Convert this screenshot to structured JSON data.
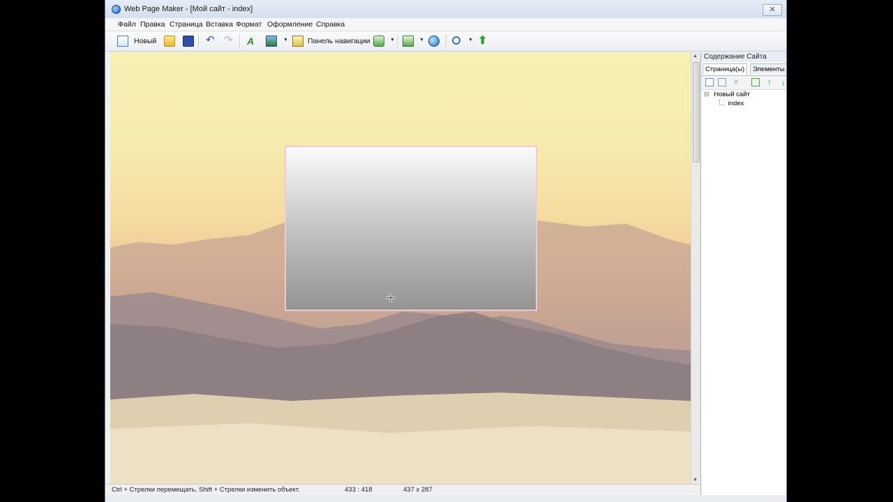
{
  "window": {
    "title": "Web Page Maker - [Мой сайт - index]",
    "close_glyph": "✕"
  },
  "menu": [
    "Файл",
    "Правка",
    "Страница",
    "Вставка",
    "Формат",
    "Оформление",
    "Справка"
  ],
  "toolbar": {
    "new_label": "Новый",
    "nav_panel_label": "Панель навигации",
    "dropdown_glyph": "▼"
  },
  "icons": {
    "new_page": "new-page-icon",
    "open": "open-folder-icon",
    "save": "save-icon",
    "undo": "undo-icon",
    "redo": "redo-icon",
    "text": "text-icon",
    "image": "image-icon",
    "navigation": "navigation-panel-icon",
    "insert": "insert-object-icon",
    "publish": "publish-icon",
    "preview": "preview-globe-icon",
    "zoom": "zoom-icon",
    "upload": "upload-arrow-icon",
    "move_cursor": "move-cursor-icon"
  },
  "canvas": {
    "background_colors": {
      "sky": "#f6f0b4",
      "mountains": "#a59594",
      "clouds": "#ede2c0"
    },
    "box_border_color": "#f0c8d8"
  },
  "scrollbar": {
    "up_glyph": "▲",
    "down_glyph": "▼"
  },
  "right_panel": {
    "title": "Содержание Сайта",
    "tabs": [
      "Страница(ы)",
      "Элементы"
    ],
    "tree": {
      "root": "Новый сайт",
      "child": "index",
      "collapse_glyph": "⊟"
    }
  },
  "status": {
    "hint": "Ctrl + Стрелки перемещать, Shift + Стрелки изменить объект.",
    "position": "433 : 418",
    "size": "437 x 287"
  }
}
